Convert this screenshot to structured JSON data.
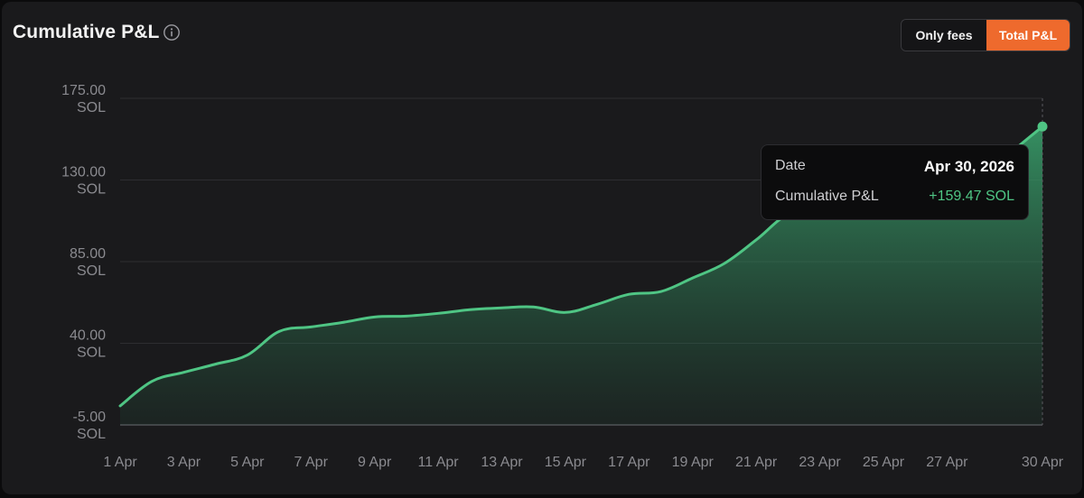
{
  "header": {
    "title": "Cumulative P&L",
    "info_icon": "info-circle-icon"
  },
  "toggle": {
    "only_fees_label": "Only fees",
    "total_label": "Total P&L",
    "active": "Total P&L"
  },
  "tooltip": {
    "date_label": "Date",
    "date_value": "Apr 30, 2026",
    "pnl_label": "Cumulative P&L",
    "pnl_value": "+159.47 SOL"
  },
  "colors": {
    "accent": "#ee6a2d",
    "line": "#4fc584",
    "background": "#1a1a1c"
  },
  "chart_data": {
    "type": "area",
    "ylim": [
      -5,
      175
    ],
    "y_ticks": [
      {
        "value": 175,
        "line1": "175.00",
        "line2": "SOL"
      },
      {
        "value": 130,
        "line1": "130.00",
        "line2": "SOL"
      },
      {
        "value": 85,
        "line1": "85.00",
        "line2": "SOL"
      },
      {
        "value": 40,
        "line1": "40.00",
        "line2": "SOL"
      },
      {
        "value": -5,
        "line1": "-5.00",
        "line2": "SOL"
      }
    ],
    "x_ticks": [
      {
        "day": 1,
        "label": "1 Apr"
      },
      {
        "day": 3,
        "label": "3 Apr"
      },
      {
        "day": 5,
        "label": "5 Apr"
      },
      {
        "day": 7,
        "label": "7 Apr"
      },
      {
        "day": 9,
        "label": "9 Apr"
      },
      {
        "day": 11,
        "label": "11 Apr"
      },
      {
        "day": 13,
        "label": "13 Apr"
      },
      {
        "day": 15,
        "label": "15 Apr"
      },
      {
        "day": 17,
        "label": "17 Apr"
      },
      {
        "day": 19,
        "label": "19 Apr"
      },
      {
        "day": 21,
        "label": "21 Apr"
      },
      {
        "day": 23,
        "label": "23 Apr"
      },
      {
        "day": 25,
        "label": "25 Apr"
      },
      {
        "day": 27,
        "label": "27 Apr"
      },
      {
        "day": 30,
        "label": "30 Apr"
      }
    ],
    "x": [
      1,
      2,
      3,
      4,
      5,
      6,
      7,
      8,
      9,
      10,
      11,
      12,
      13,
      14,
      15,
      16,
      17,
      18,
      19,
      20,
      21,
      22,
      23,
      24,
      25,
      26,
      27,
      28,
      29,
      30
    ],
    "series": [
      {
        "values": [
          5.5,
          19,
          24,
          28.5,
          33.5,
          46.5,
          49,
          51.5,
          54.5,
          55,
          56.5,
          58.5,
          59.5,
          60,
          57,
          61.5,
          67,
          68.5,
          76,
          84,
          97,
          111,
          113,
          113.5,
          114,
          114.5,
          118,
          130,
          145,
          159.47
        ]
      }
    ],
    "highlight": {
      "day": 30,
      "value": 159.47
    }
  }
}
